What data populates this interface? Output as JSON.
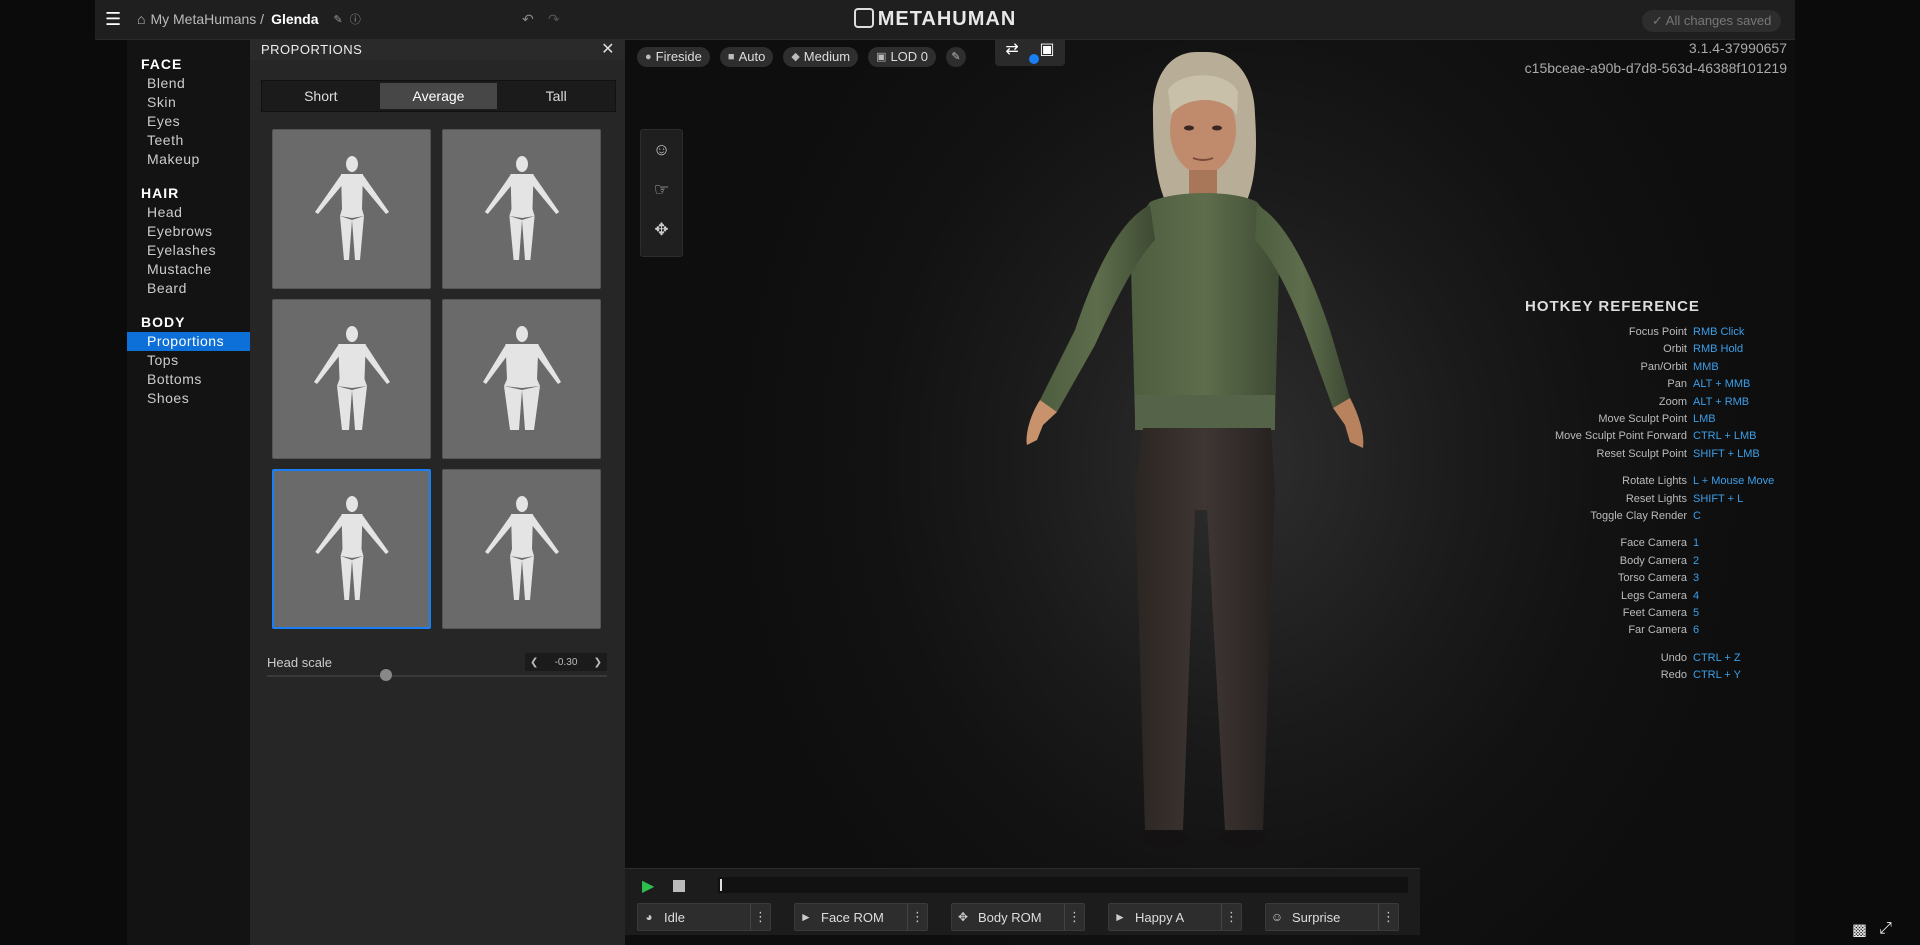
{
  "topbar": {
    "breadcrumb_root": "My MetaHumans /",
    "breadcrumb_current": "Glenda",
    "brand": "METAHUMAN",
    "save_status": "All changes saved"
  },
  "nav": {
    "sections": [
      {
        "title": "FACE",
        "items": [
          "Blend",
          "Skin",
          "Eyes",
          "Teeth",
          "Makeup"
        ]
      },
      {
        "title": "HAIR",
        "items": [
          "Head",
          "Eyebrows",
          "Eyelashes",
          "Mustache",
          "Beard"
        ]
      },
      {
        "title": "BODY",
        "items": [
          "Proportions",
          "Tops",
          "Bottoms",
          "Shoes"
        ]
      }
    ],
    "active": "Proportions"
  },
  "panel": {
    "title": "PROPORTIONS",
    "segments": [
      "Short",
      "Average",
      "Tall"
    ],
    "selected_segment": "Average",
    "selected_tile": 5,
    "head_scale_label": "Head scale",
    "head_scale_value": "-0.30",
    "head_scale_fraction": 0.35
  },
  "viewport": {
    "chips": [
      "Fireside",
      "Auto",
      "Medium",
      "LOD 0"
    ],
    "version": "3.1.4-37990657",
    "guid": "c15bceae-a90b-d7d8-563d-46388f101219"
  },
  "hotkeys": {
    "title": "HOTKEY REFERENCE",
    "rows": [
      {
        "k": "Focus Point",
        "v": "RMB Click"
      },
      {
        "k": "Orbit",
        "v": "RMB Hold"
      },
      {
        "k": "Pan/Orbit",
        "v": "MMB"
      },
      {
        "k": "Pan",
        "v": "ALT + MMB"
      },
      {
        "k": "Zoom",
        "v": "ALT + RMB"
      },
      {
        "k": "Move Sculpt Point",
        "v": "LMB"
      },
      {
        "k": "Move Sculpt Point Forward",
        "v": "CTRL + LMB"
      },
      {
        "k": "Reset Sculpt Point",
        "v": "SHIFT + LMB"
      },
      {
        "k": "Rotate Lights",
        "v": "L + Mouse Move"
      },
      {
        "k": "Reset Lights",
        "v": "SHIFT + L"
      },
      {
        "k": "Toggle Clay Render",
        "v": "C"
      },
      {
        "k": "Face Camera",
        "v": "1"
      },
      {
        "k": "Body Camera",
        "v": "2"
      },
      {
        "k": "Torso Camera",
        "v": "3"
      },
      {
        "k": "Legs Camera",
        "v": "4"
      },
      {
        "k": "Feet Camera",
        "v": "5"
      },
      {
        "k": "Far Camera",
        "v": "6"
      },
      {
        "k": "Undo",
        "v": "CTRL + Z"
      },
      {
        "k": "Redo",
        "v": "CTRL + Y"
      }
    ]
  },
  "animations": [
    "Idle",
    "Face ROM",
    "Body ROM",
    "Happy A",
    "Surprise"
  ],
  "colors": {
    "accent": "#1a7ef5",
    "play": "#2dbf4e",
    "hotkey": "#3c9ee8"
  }
}
